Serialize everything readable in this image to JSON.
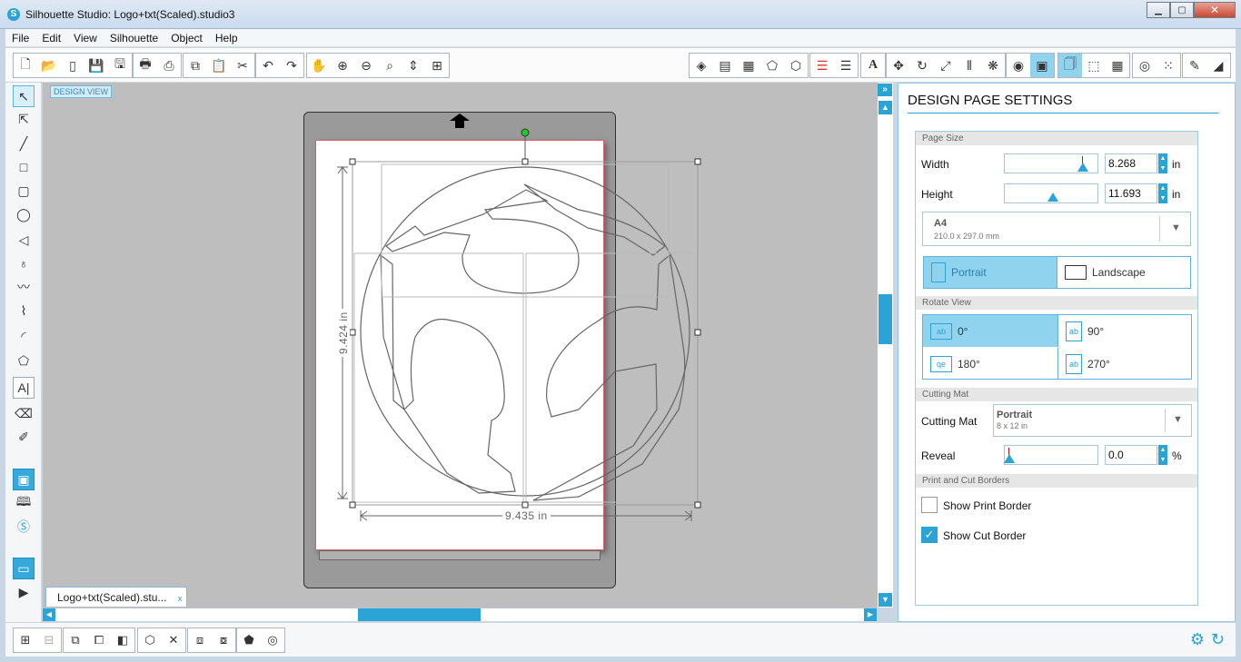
{
  "window": {
    "title": "Silhouette Studio: Logo+txt(Scaled).studio3",
    "logo_glyph": "S"
  },
  "menu": [
    "File",
    "Edit",
    "View",
    "Silhouette",
    "Object",
    "Help"
  ],
  "canvas": {
    "view_label": "DESIGN VIEW",
    "width_dim": "9.435 in",
    "height_dim": "9.424 in",
    "document_tab": "Logo+txt(Scaled).stu...",
    "tab_close": "x"
  },
  "panel": {
    "title": "DESIGN PAGE SETTINGS",
    "page_size": {
      "header": "Page Size",
      "width_label": "Width",
      "width_value": "8.268",
      "height_label": "Height",
      "height_value": "11.693",
      "unit": "in",
      "size_name": "A4",
      "size_dims": "210.0 x 297.0 mm",
      "portrait": "Portrait",
      "landscape": "Landscape"
    },
    "rotate_view": {
      "header": "Rotate View",
      "r0": "0°",
      "r90": "90°",
      "r180": "180°",
      "r270": "270°"
    },
    "cutting_mat": {
      "header": "Cutting Mat",
      "label": "Cutting Mat",
      "value": "Portrait",
      "sub": "8 x 12 in",
      "reveal_label": "Reveal",
      "reveal_value": "0.0",
      "reveal_unit": "%"
    },
    "borders": {
      "header": "Print and Cut Borders",
      "print_border": "Show Print Border",
      "print_checked": false,
      "cut_border": "Show Cut Border",
      "cut_checked": true
    }
  },
  "colors": {
    "accent": "#2aa3d6",
    "selected": "#8fd3ee",
    "mat": "#9a9a9a",
    "canvas": "#bebebe"
  }
}
